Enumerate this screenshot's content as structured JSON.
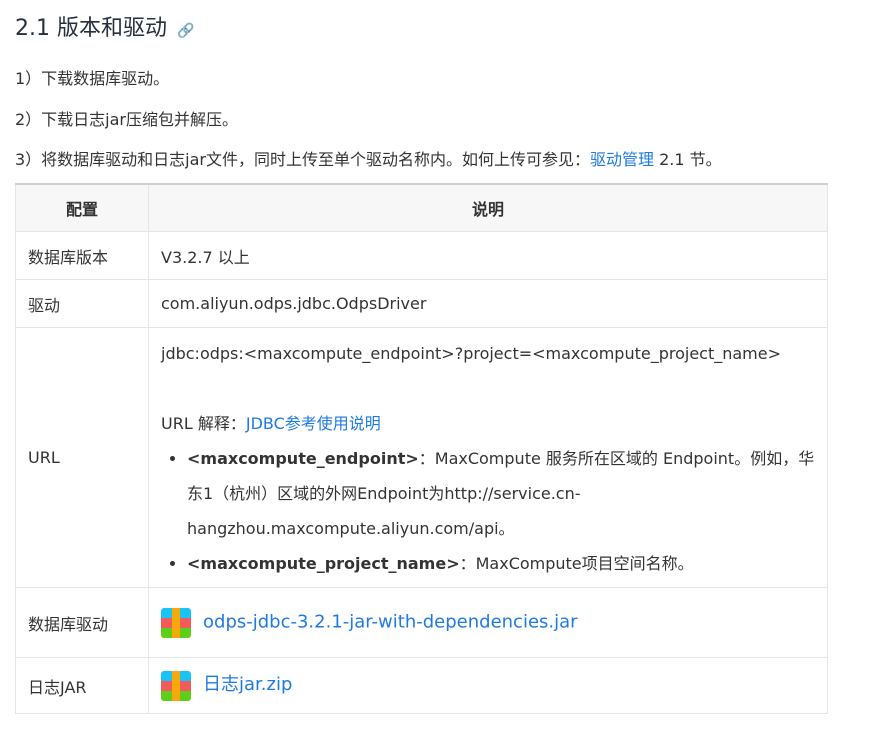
{
  "heading": "2.1 版本和驱动",
  "link_icon": "🔗",
  "steps": [
    "1）下载数据库驱动。",
    "2）下载日志jar压缩包并解压。",
    "3）将数据库驱动和日志jar文件，同时上传至单个驱动名称内。如何上传可参见："
  ],
  "step3_link": "驱动管理",
  "step3_tail": " 2.1 节。",
  "table": {
    "headers": [
      "配置",
      "说明"
    ],
    "rows": [
      {
        "key": "数据库版本",
        "value": "V3.2.7 以上"
      },
      {
        "key": "驱动",
        "value": "com.aliyun.odps.jdbc.OdpsDriver"
      }
    ],
    "url": {
      "key": "URL",
      "value": "jdbc:odps:<maxcompute_endpoint>?project=<maxcompute_project_name>",
      "explain_label": "URL 解释：",
      "explain_link": "JDBC参考使用说明",
      "bullets": [
        {
          "term": "<maxcompute_endpoint>",
          "desc": "：MaxCompute 服务所在区域的 Endpoint。例如，华东1（杭州）区域的外网Endpoint为http://service.cn-hangzhou.maxcompute.aliyun.com/api。"
        },
        {
          "term": "<maxcompute_project_name>",
          "desc": "：MaxCompute项目空间名称。"
        }
      ]
    },
    "driver": {
      "key": "数据库驱动",
      "file": "odps-jdbc-3.2.1-jar-with-dependencies.jar"
    },
    "log": {
      "key": "日志JAR",
      "file": "日志jar.zip"
    }
  }
}
